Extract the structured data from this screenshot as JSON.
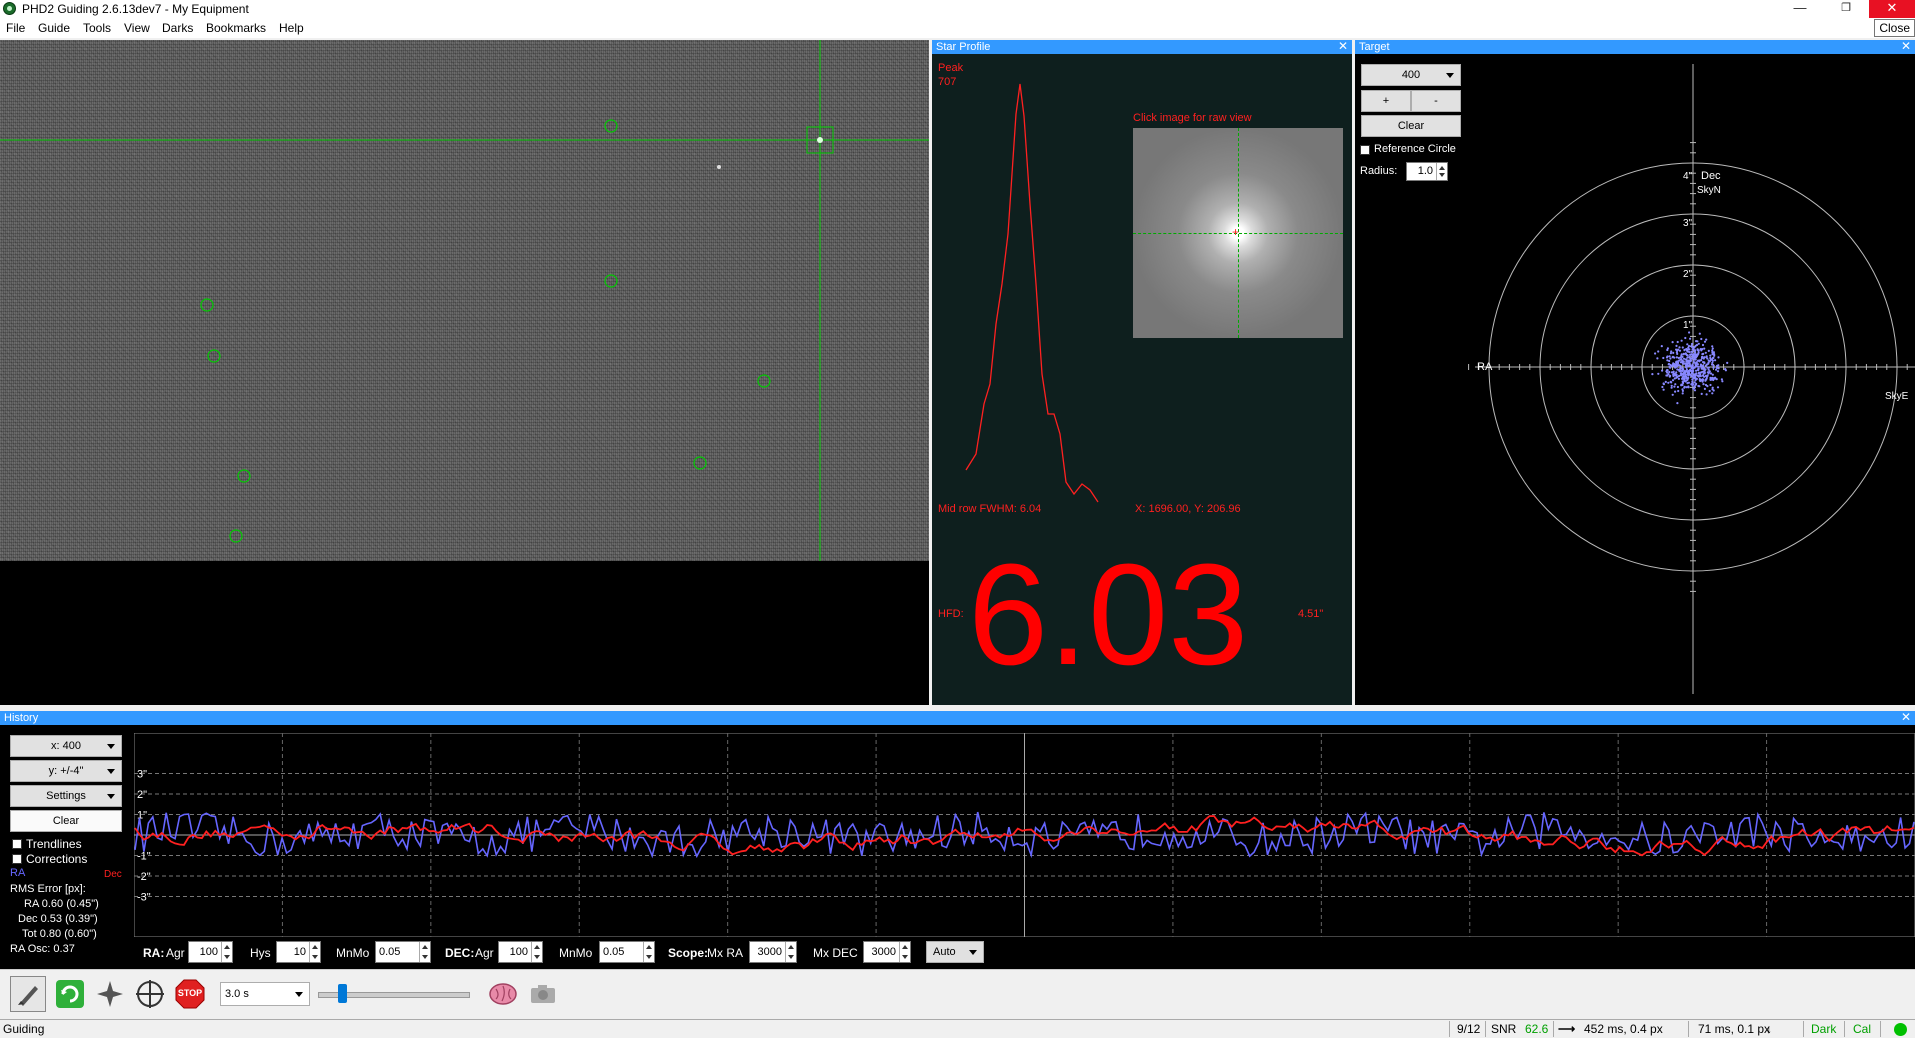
{
  "window": {
    "title": "PHD2 Guiding 2.6.13dev7 - My Equipment",
    "tooltip": "Close"
  },
  "menu": [
    "File",
    "Guide",
    "Tools",
    "View",
    "Darks",
    "Bookmarks",
    "Help"
  ],
  "star_profile": {
    "header": "Star Profile",
    "peak_label": "Peak",
    "peak_value": "707",
    "click_hint": "Click image for raw view",
    "fwhm": "Mid row FWHM: 6.04",
    "coords": "X: 1696.00, Y: 206.96",
    "hfd_label": "HFD:",
    "hfd_value": "6.03",
    "hfd_arcsec": "4.51\""
  },
  "target": {
    "header": "Target",
    "zoom": "400",
    "plus": "+",
    "minus": "-",
    "clear": "Clear",
    "reference_circle": "Reference Circle",
    "radius_label": "Radius:",
    "radius_value": "1.0",
    "axis_dec": "Dec",
    "axis_skyn": "SkyN",
    "axis_ra": "RA",
    "axis_skye": "SkyE",
    "ring_labels": [
      "1\"",
      "2\"",
      "3\"",
      "4\""
    ]
  },
  "history": {
    "header": "History",
    "x_scale": "x: 400",
    "y_scale": "y: +/-4\"",
    "settings": "Settings",
    "clear": "Clear",
    "trendlines": "Trendlines",
    "corrections": "Corrections",
    "ra_label": "RA",
    "dec_label": "Dec",
    "rms_title": "RMS Error [px]:",
    "rms_ra": "RA 0.60 (0.45\")",
    "rms_dec": "Dec 0.53 (0.39\")",
    "rms_tot": "Tot 0.80 (0.60\")",
    "ra_osc": "RA Osc: 0.37",
    "y_ticks": [
      "3\"",
      "2\"",
      "1\"",
      "-1\"",
      "-2\"",
      "-3\""
    ],
    "colors": {
      "ra": "#6666ff",
      "dec": "#ff2020"
    }
  },
  "guide_params": {
    "ra_label": "RA:",
    "agr_label": "Agr",
    "ra_agr": "100",
    "hys_label": "Hys",
    "ra_hys": "10",
    "mnmo_label": "MnMo",
    "ra_mnmo": "0.05",
    "dec_label": "DEC:",
    "dec_agr": "100",
    "dec_mnmo": "0.05",
    "scope_label": "Scope:",
    "mx_ra_label": "Mx RA",
    "mx_ra": "3000",
    "mx_dec_label": "Mx DEC",
    "mx_dec": "3000",
    "dec_mode": "Auto"
  },
  "toolbar": {
    "exposure": "3.0 s",
    "stop": "STOP",
    "icons": [
      "usb-camera-icon",
      "loop-icon",
      "auto-select-star-icon",
      "guide-crosshair-icon",
      "stop-icon",
      "brain-icon",
      "camera-settings-icon"
    ]
  },
  "status": {
    "state": "Guiding",
    "frames": "9/12",
    "snr_label": "SNR",
    "snr_value": "62.6",
    "ra_guide": "452 ms, 0.4 px",
    "dec_guide": "71 ms, 0.1 px",
    "dark": "Dark",
    "cal": "Cal"
  }
}
